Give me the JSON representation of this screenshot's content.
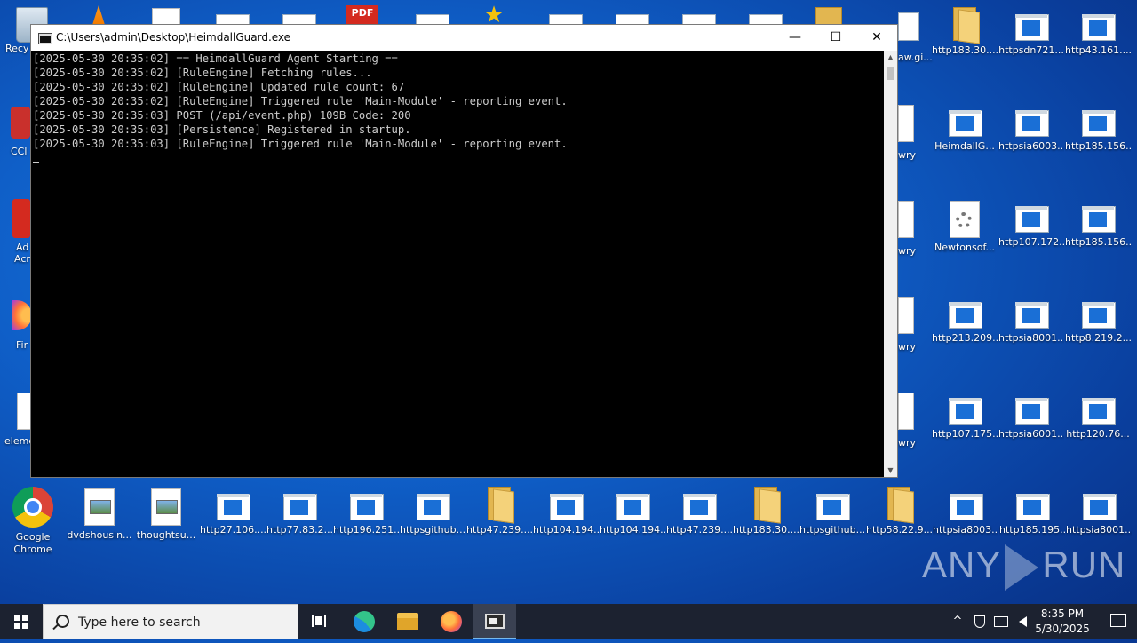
{
  "desktop": {
    "left_partial": [
      {
        "label": "Recy"
      },
      {
        "label": "CCl"
      },
      {
        "label": "Ad"
      },
      {
        "label": "Acr"
      },
      {
        "label": "Fir"
      },
      {
        "label": "eleme"
      }
    ],
    "right_partial": [
      {
        "label": "aw.gi..."
      },
      {
        "label": "wry"
      },
      {
        "label": "wry"
      },
      {
        "label": "wry"
      },
      {
        "label": "wry"
      }
    ],
    "right_icons": [
      {
        "label": "http183.30....",
        "type": "folder"
      },
      {
        "label": "httpsdn721...",
        "type": "web"
      },
      {
        "label": "http43.161....",
        "type": "web"
      },
      {
        "label": "HeimdallG...",
        "type": "web"
      },
      {
        "label": "httpsia6003...",
        "type": "web"
      },
      {
        "label": "http185.156...",
        "type": "web"
      },
      {
        "label": "Newtonsof...",
        "type": "gear"
      },
      {
        "label": "http107.172...",
        "type": "web"
      },
      {
        "label": "http185.156...",
        "type": "web"
      },
      {
        "label": "http213.209...",
        "type": "web"
      },
      {
        "label": "httpsia8001...",
        "type": "web"
      },
      {
        "label": "http8.219.2...",
        "type": "web"
      },
      {
        "label": "http107.175...",
        "type": "web"
      },
      {
        "label": "httpsia6001...",
        "type": "web"
      },
      {
        "label": "http120.76...",
        "type": "web"
      }
    ],
    "bottom_icons": [
      {
        "label": "Google Chrome",
        "type": "chrome"
      },
      {
        "label": "dvdshousin...",
        "type": "img"
      },
      {
        "label": "thoughtsu...",
        "type": "img"
      },
      {
        "label": "http27.106....",
        "type": "web"
      },
      {
        "label": "http77.83.2...",
        "type": "web"
      },
      {
        "label": "http196.251...",
        "type": "web"
      },
      {
        "label": "httpsgithub...",
        "type": "web"
      },
      {
        "label": "http47.239....",
        "type": "folder"
      },
      {
        "label": "http104.194...",
        "type": "web"
      },
      {
        "label": "http104.194...",
        "type": "web"
      },
      {
        "label": "http47.239....",
        "type": "web"
      },
      {
        "label": "http183.30....",
        "type": "folder"
      },
      {
        "label": "httpsgithub...",
        "type": "web"
      },
      {
        "label": "http58.22.9...",
        "type": "folder"
      },
      {
        "label": "httpsia8003...",
        "type": "web"
      },
      {
        "label": "http185.195...",
        "type": "web"
      },
      {
        "label": "httpsia8001...",
        "type": "web"
      }
    ]
  },
  "window": {
    "title": "C:\\Users\\admin\\Desktop\\HeimdallGuard.exe",
    "minimize": "—",
    "maximize": "☐",
    "close": "✕",
    "console_lines": [
      "[2025-05-30 20:35:02] == HeimdallGuard Agent Starting ==",
      "[2025-05-30 20:35:02] [RuleEngine] Fetching rules...",
      "[2025-05-30 20:35:02] [RuleEngine] Updated rule count: 67",
      "[2025-05-30 20:35:02] [RuleEngine] Triggered rule 'Main-Module' - reporting event.",
      "[2025-05-30 20:35:03] POST (/api/event.php) 109B Code: 200",
      "[2025-05-30 20:35:03] [Persistence] Registered in startup.",
      "[2025-05-30 20:35:03] [RuleEngine] Triggered rule 'Main-Module' - reporting event."
    ]
  },
  "taskbar": {
    "search_placeholder": "Type here to search",
    "time": "8:35 PM",
    "date": "5/30/2025",
    "tray_chevron": "^"
  },
  "watermark": {
    "left": "ANY",
    "right": "RUN"
  }
}
